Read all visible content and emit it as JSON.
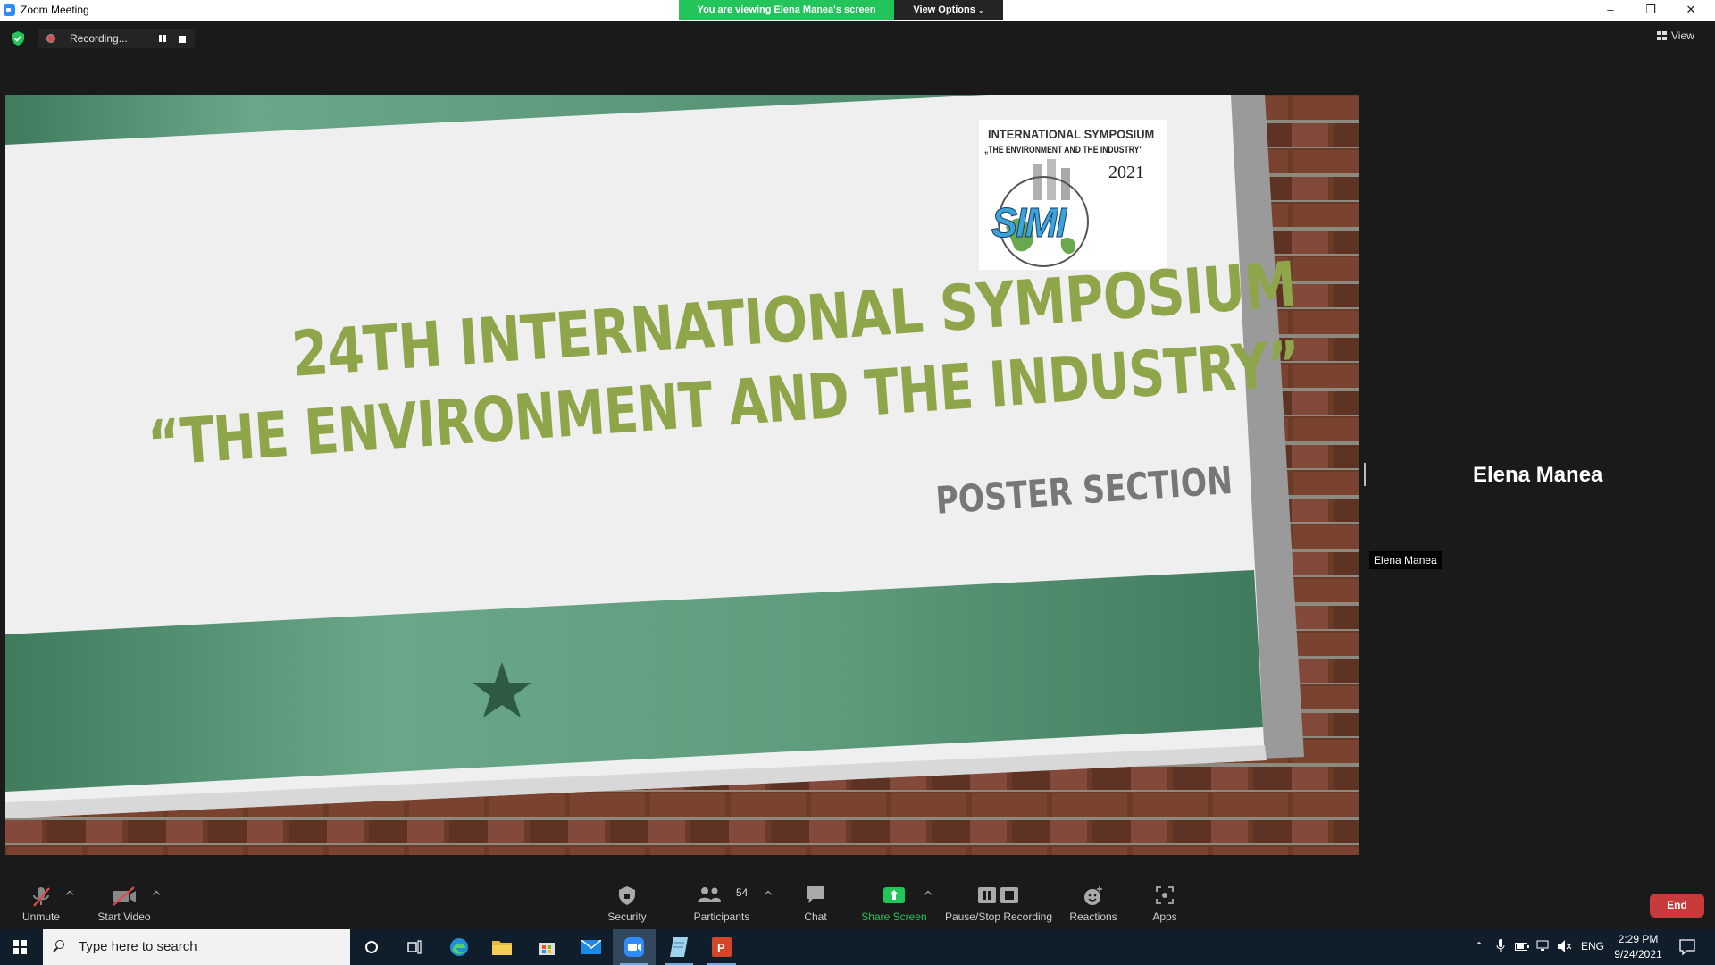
{
  "window": {
    "title": "Zoom Meeting",
    "controls": [
      "–",
      "❐",
      "✕"
    ]
  },
  "banner": {
    "viewing_text": "You are viewing Elena Manea's screen",
    "view_options_label": "View Options"
  },
  "recording": {
    "status_text": "Recording..."
  },
  "top_right": {
    "view_label": "View"
  },
  "slide": {
    "logo_line1": "INTERNATIONAL  SYMPOSIUM",
    "logo_line2": "„THE ENVIRONMENT AND THE INDUSTRY\"",
    "logo_year": "2021",
    "logo_mark": "SIMI",
    "headline_line1": "24TH INTERNATIONAL SYMPOSIUM",
    "headline_line2": "“THE ENVIRONMENT AND THE INDUSTRY”",
    "subtitle": "POSTER SECTION",
    "colors": {
      "green": "#5f9b7a",
      "olive_text": "#8fa54a",
      "paper": "#eeeeee",
      "brick": "#6b3b28"
    }
  },
  "participant": {
    "display_name": "Elena Manea",
    "name_tag": "Elena Manea"
  },
  "toolbar": {
    "unmute": "Unmute",
    "start_video": "Start Video",
    "security": "Security",
    "participants": "Participants",
    "participants_count": "54",
    "chat": "Chat",
    "share_screen": "Share Screen",
    "pause_stop_recording": "Pause/Stop Recording",
    "reactions": "Reactions",
    "apps": "Apps",
    "end": "End",
    "share_color": "#23c45a",
    "end_color": "#c93a3a"
  },
  "taskbar": {
    "search_placeholder": "Type here to search",
    "apps": [
      "cortana-icon",
      "task-view-icon",
      "edge-icon",
      "file-explorer-icon",
      "store-icon",
      "mail-icon",
      "zoom-icon",
      "notepad-icon",
      "powerpoint-icon"
    ],
    "language": "ENG",
    "time": "2:29 PM",
    "date": "9/24/2021"
  }
}
